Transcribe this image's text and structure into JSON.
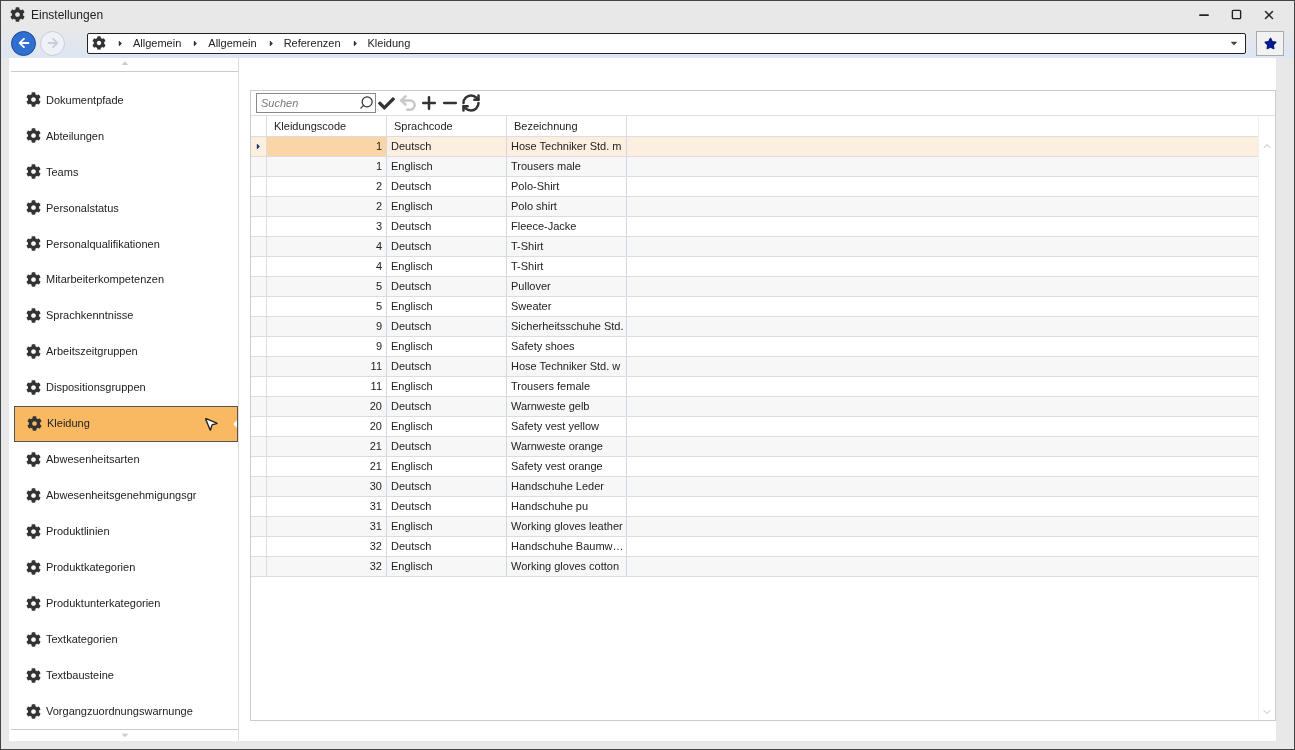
{
  "window": {
    "title": "Einstellungen"
  },
  "nav": {
    "back_disabled": false,
    "forward_disabled": true,
    "breadcrumb": [
      "Allgemein",
      "Allgemein",
      "Referenzen",
      "Kleidung"
    ]
  },
  "sidebar": {
    "items": [
      {
        "label": "Dokumentpfade",
        "selected": false
      },
      {
        "label": "Abteilungen",
        "selected": false
      },
      {
        "label": "Teams",
        "selected": false
      },
      {
        "label": "Personalstatus",
        "selected": false
      },
      {
        "label": "Personalqualifikationen",
        "selected": false
      },
      {
        "label": "Mitarbeiterkompetenzen",
        "selected": false
      },
      {
        "label": "Sprachkenntnisse",
        "selected": false
      },
      {
        "label": "Arbeitszeitgruppen",
        "selected": false
      },
      {
        "label": "Dispositionsgruppen",
        "selected": false
      },
      {
        "label": "Kleidung",
        "selected": true
      },
      {
        "label": "Abwesenheitsarten",
        "selected": false
      },
      {
        "label": "Abwesenheitsgenehmigungsgr",
        "selected": false
      },
      {
        "label": "Produktlinien",
        "selected": false
      },
      {
        "label": "Produktkategorien",
        "selected": false
      },
      {
        "label": "Produktunterkategorien",
        "selected": false
      },
      {
        "label": "Textkategorien",
        "selected": false
      },
      {
        "label": "Textbausteine",
        "selected": false
      },
      {
        "label": "Vorgangzuordnungswarnunge",
        "selected": false
      }
    ]
  },
  "grid": {
    "search": {
      "placeholder": "Suchen"
    },
    "tools": [
      {
        "kind": "save",
        "disabled": false
      },
      {
        "kind": "undo",
        "disabled": true
      },
      {
        "kind": "add",
        "disabled": false
      },
      {
        "kind": "remove",
        "disabled": false
      },
      {
        "kind": "refresh",
        "disabled": false
      }
    ],
    "columns": [
      "Kleidungscode",
      "Sprachcode",
      "Bezeichnung"
    ],
    "rows": [
      {
        "cells": [
          "1",
          "Deutsch",
          "Hose Techniker Std. m"
        ],
        "selected": true
      },
      {
        "cells": [
          "1",
          "Englisch",
          "Trousers male"
        ],
        "selected": false
      },
      {
        "cells": [
          "2",
          "Deutsch",
          "Polo-Shirt"
        ],
        "selected": false
      },
      {
        "cells": [
          "2",
          "Englisch",
          "Polo shirt"
        ],
        "selected": false
      },
      {
        "cells": [
          "3",
          "Deutsch",
          "Fleece-Jacke"
        ],
        "selected": false
      },
      {
        "cells": [
          "4",
          "Deutsch",
          "T-Shirt"
        ],
        "selected": false
      },
      {
        "cells": [
          "4",
          "Englisch",
          "T-Shirt"
        ],
        "selected": false
      },
      {
        "cells": [
          "5",
          "Deutsch",
          "Pullover"
        ],
        "selected": false
      },
      {
        "cells": [
          "5",
          "Englisch",
          "Sweater"
        ],
        "selected": false
      },
      {
        "cells": [
          "9",
          "Deutsch",
          "Sicherheitsschuhe Std."
        ],
        "selected": false
      },
      {
        "cells": [
          "9",
          "Englisch",
          "Safety shoes"
        ],
        "selected": false
      },
      {
        "cells": [
          "11",
          "Deutsch",
          "Hose Techniker Std. w"
        ],
        "selected": false
      },
      {
        "cells": [
          "11",
          "Englisch",
          "Trousers female"
        ],
        "selected": false
      },
      {
        "cells": [
          "20",
          "Deutsch",
          "Warnweste gelb"
        ],
        "selected": false
      },
      {
        "cells": [
          "20",
          "Englisch",
          "Safety vest yellow"
        ],
        "selected": false
      },
      {
        "cells": [
          "21",
          "Deutsch",
          "Warnweste orange"
        ],
        "selected": false
      },
      {
        "cells": [
          "21",
          "Englisch",
          "Safety vest orange"
        ],
        "selected": false
      },
      {
        "cells": [
          "30",
          "Deutsch",
          "Handschuhe Leder"
        ],
        "selected": false
      },
      {
        "cells": [
          "31",
          "Deutsch",
          "Handschuhe pu"
        ],
        "selected": false
      },
      {
        "cells": [
          "31",
          "Englisch",
          "Working gloves leather"
        ],
        "selected": false
      },
      {
        "cells": [
          "32",
          "Deutsch",
          "Handschuhe Baumw…"
        ],
        "selected": false
      },
      {
        "cells": [
          "32",
          "Englisch",
          "Working gloves cotton"
        ],
        "selected": false
      }
    ]
  }
}
